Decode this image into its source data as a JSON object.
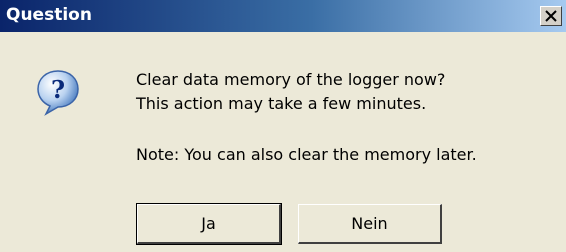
{
  "dialog": {
    "title": "Question",
    "icon": "question-icon",
    "message_line1": "Clear data memory of the logger now?",
    "message_line2": "This action may take a few minutes.",
    "note": "Note: You can also clear the memory later.",
    "buttons": {
      "yes_label": "Ja",
      "no_label": "Nein"
    }
  }
}
